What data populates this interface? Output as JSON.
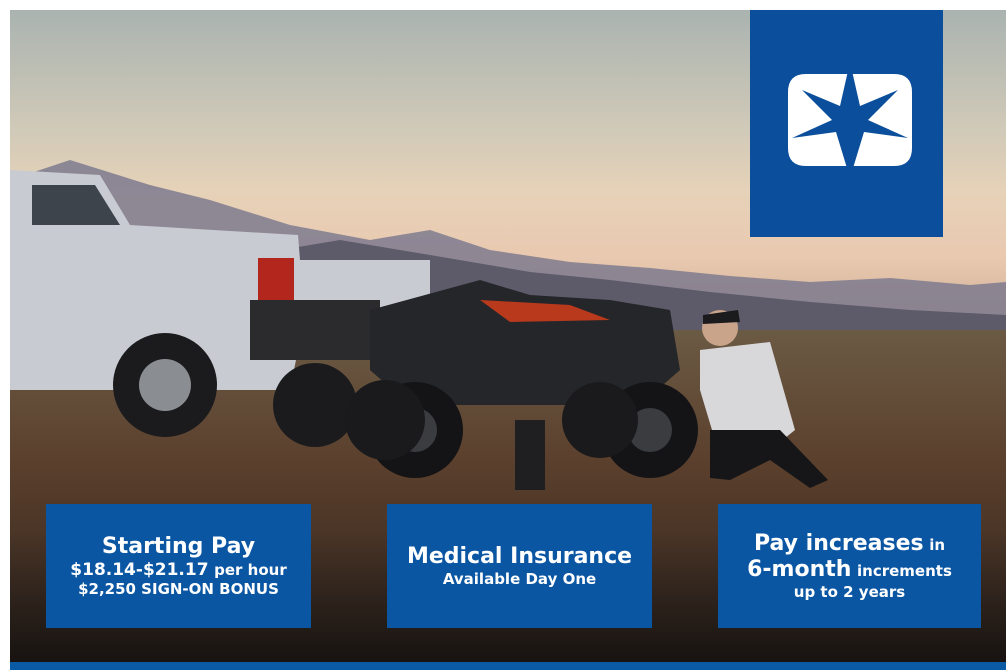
{
  "cards": {
    "starting_pay": {
      "title": "Starting Pay",
      "rate": "$18.14-$21.17",
      "rate_suffix": "per hour",
      "bonus": "$2,250 SIGN-ON BONUS"
    },
    "medical": {
      "title": "Medical Insurance",
      "subtitle": "Available Day One"
    },
    "increases": {
      "line1_bold": "Pay increases",
      "line1_small": "in",
      "line2_bold": "6-month",
      "line2_small": "increments",
      "line3": "up to 2 years"
    }
  },
  "colors": {
    "brand_blue": "#0b56a3",
    "logo_tile": "#0b4f9c"
  },
  "icons": {
    "logo": "north-star-logo-icon"
  }
}
